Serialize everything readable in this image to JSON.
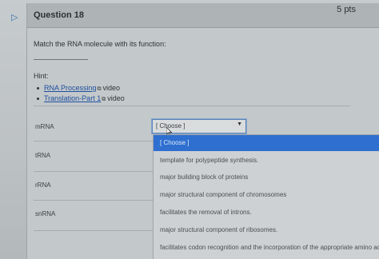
{
  "question": {
    "title": "Question 18",
    "points": "5 pts",
    "prompt": "Match the RNA molecule with its function:",
    "hint_label": "Hint:"
  },
  "hints": [
    {
      "link": "RNA Processing",
      "suffix": "video"
    },
    {
      "link": "Translation-Part 1",
      "suffix": "video"
    }
  ],
  "terms": [
    "mRNA",
    "tRNA",
    "rRNA",
    "snRNA"
  ],
  "select": {
    "value": "[ Choose ]"
  },
  "options": [
    "[ Choose ]",
    "template for polypeptide synthesis.",
    "major building block of proteins",
    "major structural component of chromosomes",
    "facilitates the removal of introns.",
    "major structural component of ribosomes.",
    "facilitates codon recognition and the incorporation of the appropriate amino acid."
  ],
  "colors": {
    "accent": "#2e6fd0",
    "link": "#1f4fa0"
  }
}
